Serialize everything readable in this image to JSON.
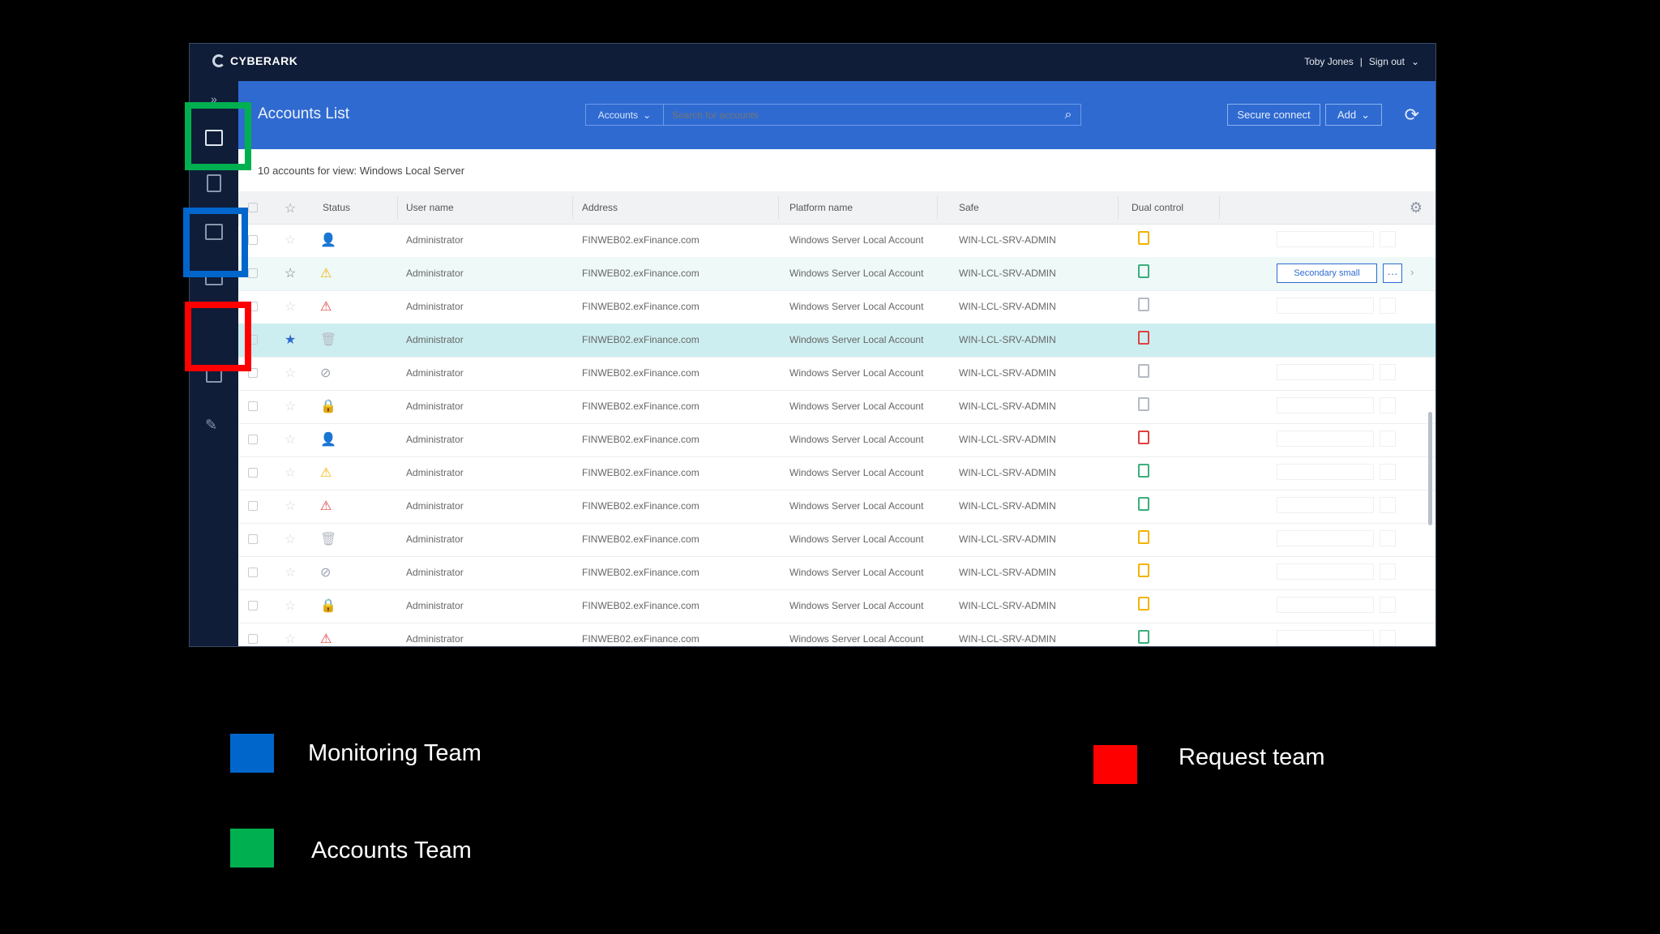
{
  "topbar": {
    "brand": "CYBERARK",
    "user": "Toby Jones",
    "separator": "|",
    "signout": "Sign out"
  },
  "header": {
    "title": "Accounts List",
    "search_category": "Accounts",
    "search_placeholder": "Search for accounts",
    "secure_connect": "Secure connect",
    "add": "Add"
  },
  "subheader": {
    "count_text": "10 accounts for view: Windows Local Server"
  },
  "columns": {
    "status": "Status",
    "user": "User name",
    "address": "Address",
    "platform": "Platform name",
    "safe": "Safe",
    "dual": "Dual control"
  },
  "row_action": {
    "button": "Secondary small",
    "more": "···"
  },
  "rows": [
    {
      "user": "Administrator",
      "address": "FINWEB02.exFinance.com",
      "platform": "Windows Server Local Account",
      "safe": "WIN-LCL-SRV-ADMIN"
    },
    {
      "user": "Administrator",
      "address": "FINWEB02.exFinance.com",
      "platform": "Windows Server Local Account",
      "safe": "WIN-LCL-SRV-ADMIN"
    },
    {
      "user": "Administrator",
      "address": "FINWEB02.exFinance.com",
      "platform": "Windows Server Local Account",
      "safe": "WIN-LCL-SRV-ADMIN"
    },
    {
      "user": "Administrator",
      "address": "FINWEB02.exFinance.com",
      "platform": "Windows Server Local Account",
      "safe": "WIN-LCL-SRV-ADMIN"
    },
    {
      "user": "Administrator",
      "address": "FINWEB02.exFinance.com",
      "platform": "Windows Server Local Account",
      "safe": "WIN-LCL-SRV-ADMIN"
    },
    {
      "user": "Administrator",
      "address": "FINWEB02.exFinance.com",
      "platform": "Windows Server Local Account",
      "safe": "WIN-LCL-SRV-ADMIN"
    },
    {
      "user": "Administrator",
      "address": "FINWEB02.exFinance.com",
      "platform": "Windows Server Local Account",
      "safe": "WIN-LCL-SRV-ADMIN"
    },
    {
      "user": "Administrator",
      "address": "FINWEB02.exFinance.com",
      "platform": "Windows Server Local Account",
      "safe": "WIN-LCL-SRV-ADMIN"
    },
    {
      "user": "Administrator",
      "address": "FINWEB02.exFinance.com",
      "platform": "Windows Server Local Account",
      "safe": "WIN-LCL-SRV-ADMIN"
    },
    {
      "user": "Administrator",
      "address": "FINWEB02.exFinance.com",
      "platform": "Windows Server Local Account",
      "safe": "WIN-LCL-SRV-ADMIN"
    },
    {
      "user": "Administrator",
      "address": "FINWEB02.exFinance.com",
      "platform": "Windows Server Local Account",
      "safe": "WIN-LCL-SRV-ADMIN"
    },
    {
      "user": "Administrator",
      "address": "FINWEB02.exFinance.com",
      "platform": "Windows Server Local Account",
      "safe": "WIN-LCL-SRV-ADMIN"
    },
    {
      "user": "Administrator",
      "address": "FINWEB02.exFinance.com",
      "platform": "Windows Server Local Account",
      "safe": "WIN-LCL-SRV-ADMIN"
    }
  ],
  "legend": {
    "monitoring": "Monitoring Team",
    "accounts": "Accounts Team",
    "request": "Request team"
  },
  "colors": {
    "monitoring": "#0066cc",
    "accounts": "#00b050",
    "request": "#ff0000",
    "brand_blue": "#2f6ad1",
    "nav": "#0f1d38"
  }
}
